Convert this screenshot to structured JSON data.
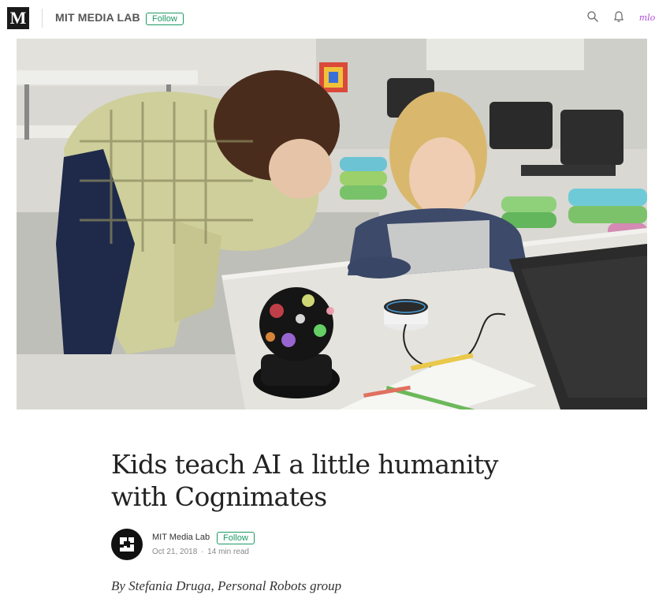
{
  "header": {
    "logo_letter": "M",
    "publication": "MIT MEDIA LAB",
    "follow_label": "Follow",
    "icons": [
      "search-icon",
      "bell-icon"
    ],
    "user_avatar_text": "mlo"
  },
  "hero_image": {
    "subject": "kids-classroom-photo"
  },
  "article": {
    "title": "Kids teach AI a little humanity with Cognimates",
    "byline": {
      "publication": "MIT Media Lab",
      "follow_label": "Follow",
      "date": "Oct 21, 2018",
      "separator": "·",
      "read_time": "14 min read"
    },
    "author_line": "By Stefania Druga, Personal Robots group"
  },
  "colors": {
    "accent": "#1c9963",
    "text": "#222222",
    "muted": "#888888",
    "logo_bg": "#1a1a1a",
    "avatar_accent": "#b04ed8"
  }
}
